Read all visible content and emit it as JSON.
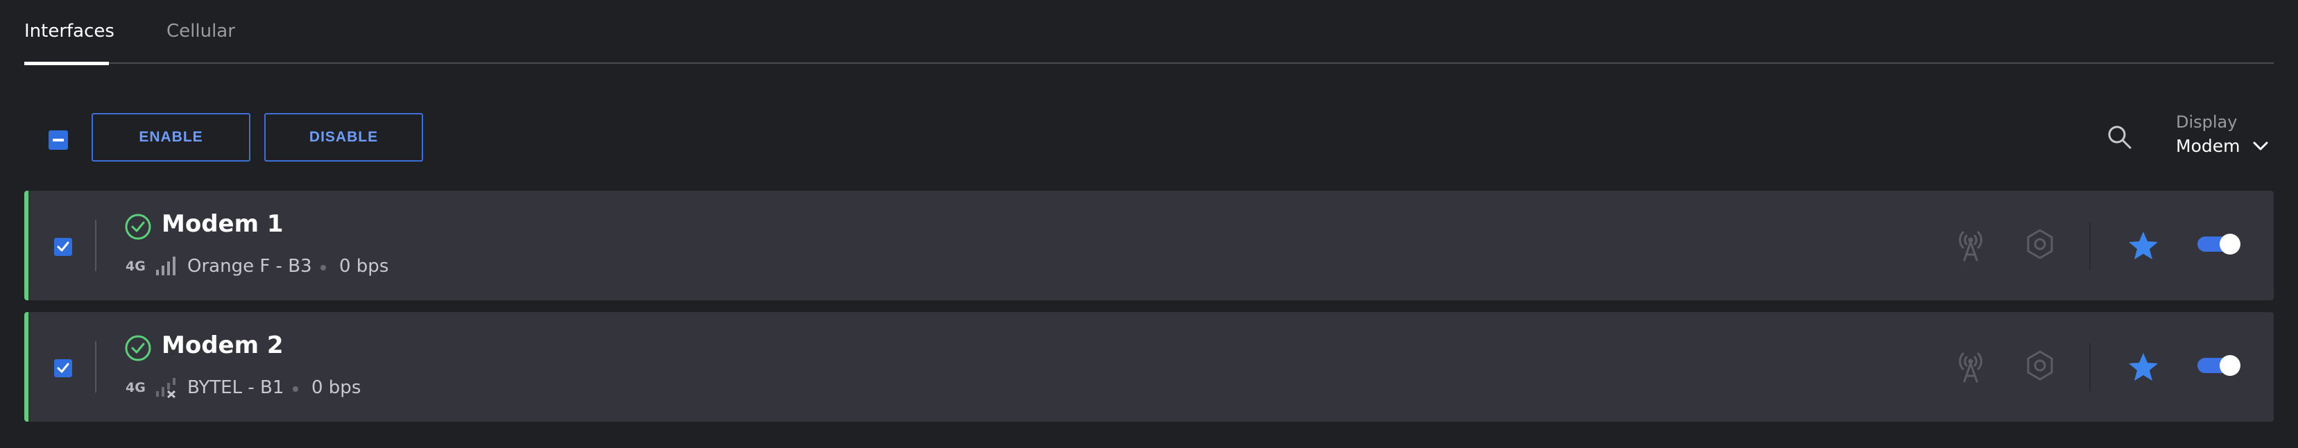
{
  "tabs": [
    {
      "label": "Interfaces",
      "active": true
    },
    {
      "label": "Cellular",
      "active": false
    }
  ],
  "toolbar": {
    "enable_label": "ENABLE",
    "disable_label": "DISABLE",
    "display_label": "Display",
    "display_value": "Modem"
  },
  "icons": {
    "search": "search-icon",
    "chevron": "chevron-down-icon",
    "status": "check-circle-icon",
    "signal": "signal-bars-icon",
    "antenna": "antenna-icon",
    "settings": "gear-icon",
    "favorite": "star-icon"
  },
  "colors": {
    "accent": "#2f6fe0",
    "status_ok": "#5ad17a",
    "background": "#1f2023",
    "row_background": "#34353c"
  },
  "modems": [
    {
      "name": "Modem 1",
      "technology": "4G",
      "carrier": "Orange F - B3",
      "speed": "0 bps",
      "checked": true,
      "enabled": true,
      "favorite": true,
      "signal": "bars"
    },
    {
      "name": "Modem 2",
      "technology": "4G",
      "carrier": "BYTEL - B1",
      "speed": "0 bps",
      "checked": true,
      "enabled": true,
      "favorite": true,
      "signal": "no-signal"
    }
  ]
}
